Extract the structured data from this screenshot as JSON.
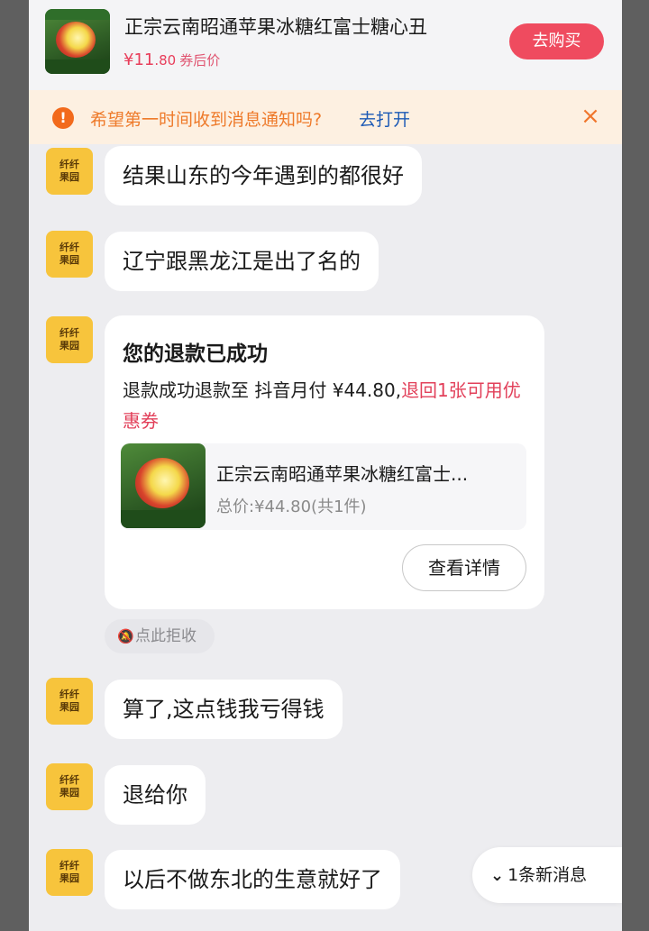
{
  "product": {
    "title": "正宗云南昭通苹果冰糖红富士糖心丑",
    "price_symbol": "¥11",
    "price_decimal": ".80",
    "price_label": "券后价",
    "buy_label": "去购买"
  },
  "notification": {
    "text": "希望第一时间收到消息通知吗?",
    "link": "去打开",
    "warn_glyph": "!",
    "close_glyph": "×"
  },
  "avatar": {
    "line1": "纤纤",
    "line2": "果园"
  },
  "messages": [
    {
      "text": "结果山东的今年遇到的都很好"
    },
    {
      "text": "辽宁跟黑龙江是出了名的"
    },
    {
      "text": "算了,这点钱我亏得钱"
    },
    {
      "text": "退给你"
    },
    {
      "text": "以后不做东北的生意就好了"
    }
  ],
  "refund_card": {
    "title": "您的退款已成功",
    "body": "退款成功退款至 抖音月付 ¥44.80,",
    "highlight": "退回1张可用优惠券",
    "order_name": "正宗云南昭通苹果冰糖红富士...",
    "order_total": "总价:¥44.80(共1件)",
    "detail_label": "查看详情"
  },
  "refuse_chip": {
    "label": "点此拒收"
  },
  "new_message": {
    "label": "1条新消息"
  },
  "colors": {
    "accent_red": "#ef4b5f",
    "price_red": "#e83d5a",
    "notify_orange": "#ee7a2a",
    "link_blue": "#1b59b5",
    "avatar_yellow": "#f7c43c"
  }
}
